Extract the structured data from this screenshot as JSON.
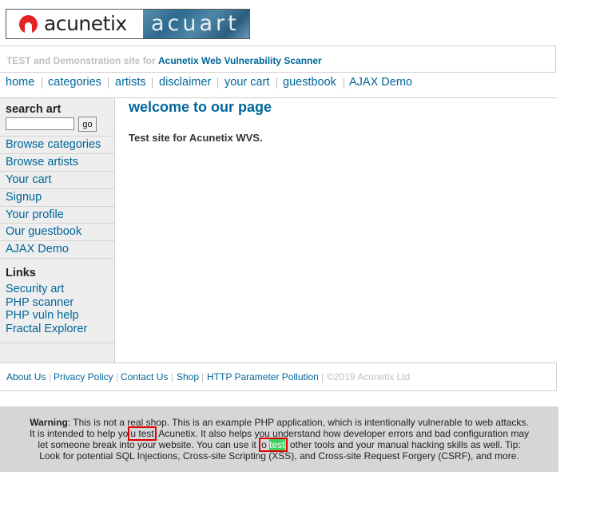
{
  "logo": {
    "brand": "acunetix",
    "product": "acuart"
  },
  "tagline": {
    "prefix": "TEST and Demonstration site for",
    "link": "Acunetix Web Vulnerability Scanner"
  },
  "topnav": [
    "home",
    "categories",
    "artists",
    "disclaimer",
    "your cart",
    "guestbook",
    "AJAX Demo"
  ],
  "sidebar": {
    "search_label": "search art",
    "search_value": "",
    "go_label": "go",
    "items": [
      "Browse categories",
      "Browse artists",
      "Your cart",
      "Signup",
      "Your profile",
      "Our guestbook",
      "AJAX Demo"
    ],
    "links_heading": "Links",
    "links": [
      "Security art",
      "PHP scanner",
      "PHP vuln help",
      "Fractal Explorer"
    ]
  },
  "main": {
    "title": "welcome to our page",
    "text": "Test site for Acunetix WVS."
  },
  "footer": {
    "links": [
      "About Us",
      "Privacy Policy",
      "Contact Us",
      "Shop",
      "HTTP Parameter Pollution"
    ],
    "copyright": "©2019 Acunetix Ltd"
  },
  "warning": {
    "label": "Warning",
    "line1_rest": ": This is not a real shop. This is an example PHP application, which is intentionally vulnerable to web attacks.",
    "line2_a": "It is intended to help yo",
    "line2_hl": "u test",
    "line2_b": " Acunetix. It also helps you understand how developer errors and bad configuration may",
    "line3_a": "let someone break into your website. You can use it ",
    "line3_hl_pre": "o ",
    "line3_hl": "test",
    "line3_b": " other tools and your manual hacking skills as well. Tip:",
    "line4": "Look for potential SQL Injections, Cross-site Scripting (XSS), and Cross-site Request Forgery (CSRF), and more."
  },
  "colors": {
    "link": "#006699",
    "sidebar_bg": "#eeeeee",
    "warning_bg": "#d6d6d6",
    "highlight_box": "#e00000",
    "highlight_fill": "#3fcf5e"
  }
}
